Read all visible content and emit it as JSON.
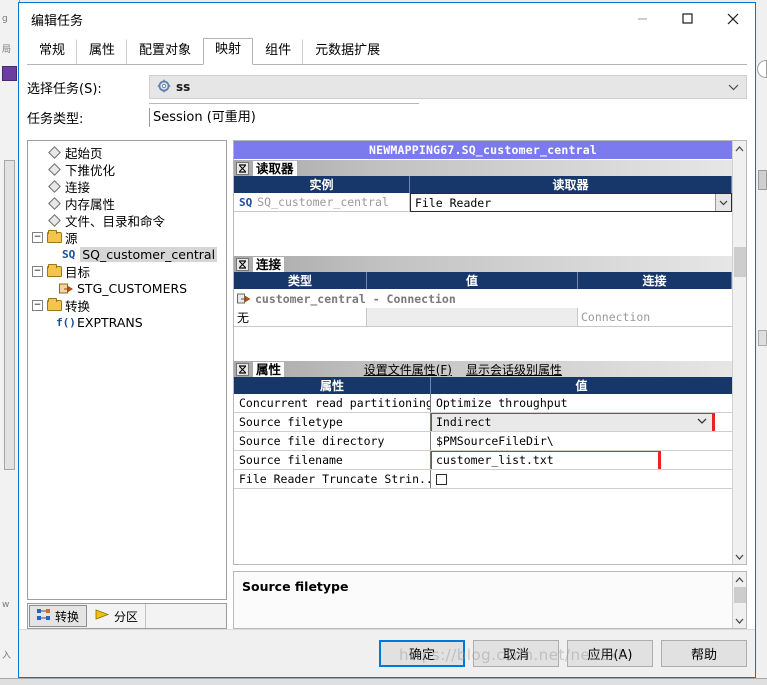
{
  "window": {
    "title": "编辑任务",
    "minimize_label": "minimize",
    "maximize_label": "maximize",
    "close_label": "close"
  },
  "tabs": [
    {
      "label": "常规",
      "active": false
    },
    {
      "label": "属性",
      "active": false
    },
    {
      "label": "配置对象",
      "active": false
    },
    {
      "label": "映射",
      "active": true
    },
    {
      "label": "组件",
      "active": false
    },
    {
      "label": "元数据扩展",
      "active": false
    }
  ],
  "form": {
    "select_task_label": "选择任务(S):",
    "select_task_value": "ss",
    "task_type_label": "任务类型:",
    "task_type_value": "Session (可重用)"
  },
  "tree": {
    "items": [
      {
        "label": "起始页",
        "icon": "diamond-icon",
        "indent": 1,
        "expander": "none",
        "selected": false
      },
      {
        "label": "下推优化",
        "icon": "diamond-icon",
        "indent": 1,
        "expander": "none",
        "selected": false
      },
      {
        "label": "连接",
        "icon": "diamond-icon",
        "indent": 1,
        "expander": "none",
        "selected": false
      },
      {
        "label": "内存属性",
        "icon": "diamond-icon",
        "indent": 1,
        "expander": "none",
        "selected": false
      },
      {
        "label": "文件、目录和命令",
        "icon": "diamond-icon",
        "indent": 1,
        "expander": "none",
        "selected": false
      },
      {
        "label": "源",
        "icon": "folder-icon",
        "indent": 0,
        "expander": "minus",
        "selected": false
      },
      {
        "label": "SQ_customer_central",
        "icon": "sq-icon",
        "indent": 2,
        "expander": "none",
        "selected": true
      },
      {
        "label": "目标",
        "icon": "folder-icon",
        "indent": 0,
        "expander": "minus",
        "selected": false
      },
      {
        "label": "STG_CUSTOMERS",
        "icon": "target-icon",
        "indent": 2,
        "expander": "none",
        "selected": false
      },
      {
        "label": "转换",
        "icon": "folder-icon",
        "indent": 0,
        "expander": "minus",
        "selected": false
      },
      {
        "label": "EXPTRANS",
        "icon": "fx-icon",
        "indent": 2,
        "expander": "none",
        "selected": false
      }
    ],
    "bottom_tabs": [
      {
        "label": "转换",
        "icon": "transformation-icon",
        "active": true
      },
      {
        "label": "分区",
        "icon": "partition-arrow-icon",
        "active": false
      }
    ]
  },
  "mapping": {
    "banner": "NEWMAPPING67.SQ_customer_central",
    "reader": {
      "section_title": "读取器",
      "collapse_glyph": "↑↓",
      "columns": [
        "实例",
        "读取器"
      ],
      "rows": [
        {
          "instance": "SQ_customer_central",
          "reader": "File Reader"
        }
      ]
    },
    "connections": {
      "section_title": "连接",
      "columns": [
        "类型",
        "值",
        "连接"
      ],
      "group_row": "customer_central - Connection",
      "rows": [
        {
          "type": "无",
          "value": "",
          "connection": "Connection"
        }
      ]
    },
    "properties": {
      "section_title": "属性",
      "links": [
        "设置文件属性(F)",
        "显示会话级别属性"
      ],
      "columns": [
        "属性",
        "值"
      ],
      "rows": [
        {
          "name": "Concurrent read partitioning",
          "value": "Optimize throughput",
          "kind": "text",
          "highlight": false
        },
        {
          "name": "Source filetype",
          "value": "Indirect",
          "kind": "dropdown",
          "highlight": true
        },
        {
          "name": "Source file directory",
          "value": "$PMSourceFileDir\\",
          "kind": "text",
          "highlight": false
        },
        {
          "name": "Source filename",
          "value": "customer_list.txt",
          "kind": "textbox",
          "highlight": true
        },
        {
          "name": "File Reader Truncate Strin...",
          "value": "",
          "kind": "checkbox",
          "highlight": false
        }
      ]
    }
  },
  "description": {
    "text": "Source filetype"
  },
  "footer": {
    "buttons": [
      {
        "label": "确定",
        "default": true
      },
      {
        "label": "取消",
        "default": false
      },
      {
        "label": "应用(A)",
        "default": false
      },
      {
        "label": "帮助",
        "default": false
      }
    ],
    "watermark": "https://blog.csdn.net/neuzxl"
  },
  "colors": {
    "accent": "#0078d7",
    "banner_purple": "#7b7bef",
    "grid_header_navy": "#17376b",
    "highlight_red": "#ee2222",
    "folder_yellow": "#f5c44c"
  }
}
